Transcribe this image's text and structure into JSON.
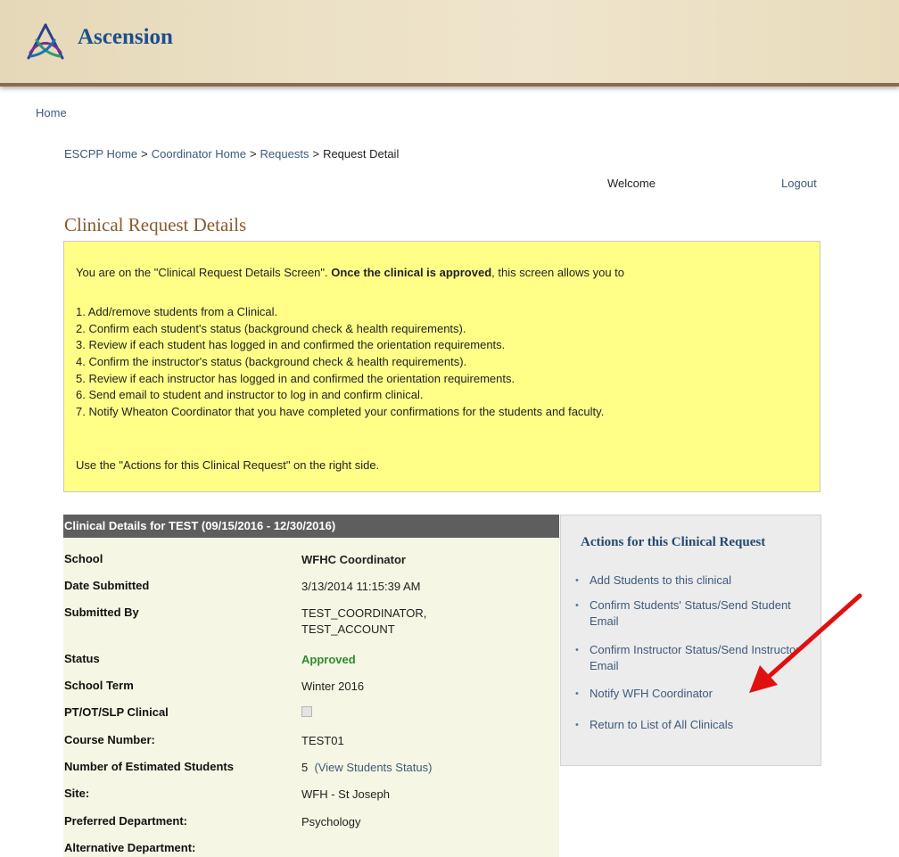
{
  "header": {
    "logo_text": "Ascension"
  },
  "nav": {
    "home": "Home"
  },
  "breadcrumb": {
    "items": [
      "ESCPP Home",
      "Coordinator Home",
      "Requests",
      "Request Detail"
    ],
    "separator": ">"
  },
  "user": {
    "welcome": "Welcome",
    "logout": "Logout"
  },
  "page_title": "Clinical Request Details",
  "instructions": {
    "intro_before": "You are on the \"Clinical Request Details Screen\". ",
    "intro_bold": "Once the clinical is approved",
    "intro_after": ", this screen allows you to",
    "items": [
      "1. Add/remove students from a Clinical.",
      "2. Confirm each student's status (background check & health requirements).",
      "3. Review if each student has logged in and confirmed the orientation requirements.",
      "4. Confirm the instructor's status (background check & health requirements).",
      "5. Review if each instructor has logged in and confirmed the orientation requirements.",
      "6. Send email to student and instructor to log in and confirm clinical.",
      "7. Notify Wheaton Coordinator that you have completed your confirmations for the students and faculty."
    ],
    "footer": "Use the \"Actions for this Clinical Request\" on the right side."
  },
  "details": {
    "header": "Clinical Details for TEST (09/15/2016 - 12/30/2016)",
    "rows": [
      {
        "label": "School",
        "value": "WFHC Coordinator"
      },
      {
        "label": "Date Submitted",
        "value": "3/13/2014 11:15:39 AM"
      },
      {
        "label": "Submitted By",
        "value_line1": "TEST_COORDINATOR,",
        "value_line2": "TEST_ACCOUNT"
      },
      {
        "label": "Status",
        "value": "Approved"
      },
      {
        "label": "School Term",
        "value": "Winter 2016"
      },
      {
        "label": "PT/OT/SLP Clinical",
        "checked": false
      },
      {
        "label": "Course Number:",
        "value": "TEST01"
      },
      {
        "label": "Number of Estimated Students",
        "value": "5",
        "link": "(View Students Status)"
      },
      {
        "label": "Site:",
        "value": "WFH - St Joseph"
      },
      {
        "label": "Preferred Department:",
        "value": "Psychology"
      },
      {
        "label": "Alternative Department:",
        "value": ""
      }
    ]
  },
  "actions": {
    "title": "Actions for this Clinical Request",
    "items": [
      "Add Students to this clinical",
      "Confirm Students' Status/Send Student Email",
      "Confirm Instructor Status/Send Instructor Email",
      "Notify WFH Coordinator",
      "Return to List of All Clinicals"
    ]
  },
  "colors": {
    "brand_blue": "#1e4f8c",
    "title_brown": "#8a5a2b",
    "link": "#3d5a7a",
    "notice_yellow": "#ffff88",
    "status_green": "#2e8b2e",
    "arrow_red": "#e01010"
  }
}
